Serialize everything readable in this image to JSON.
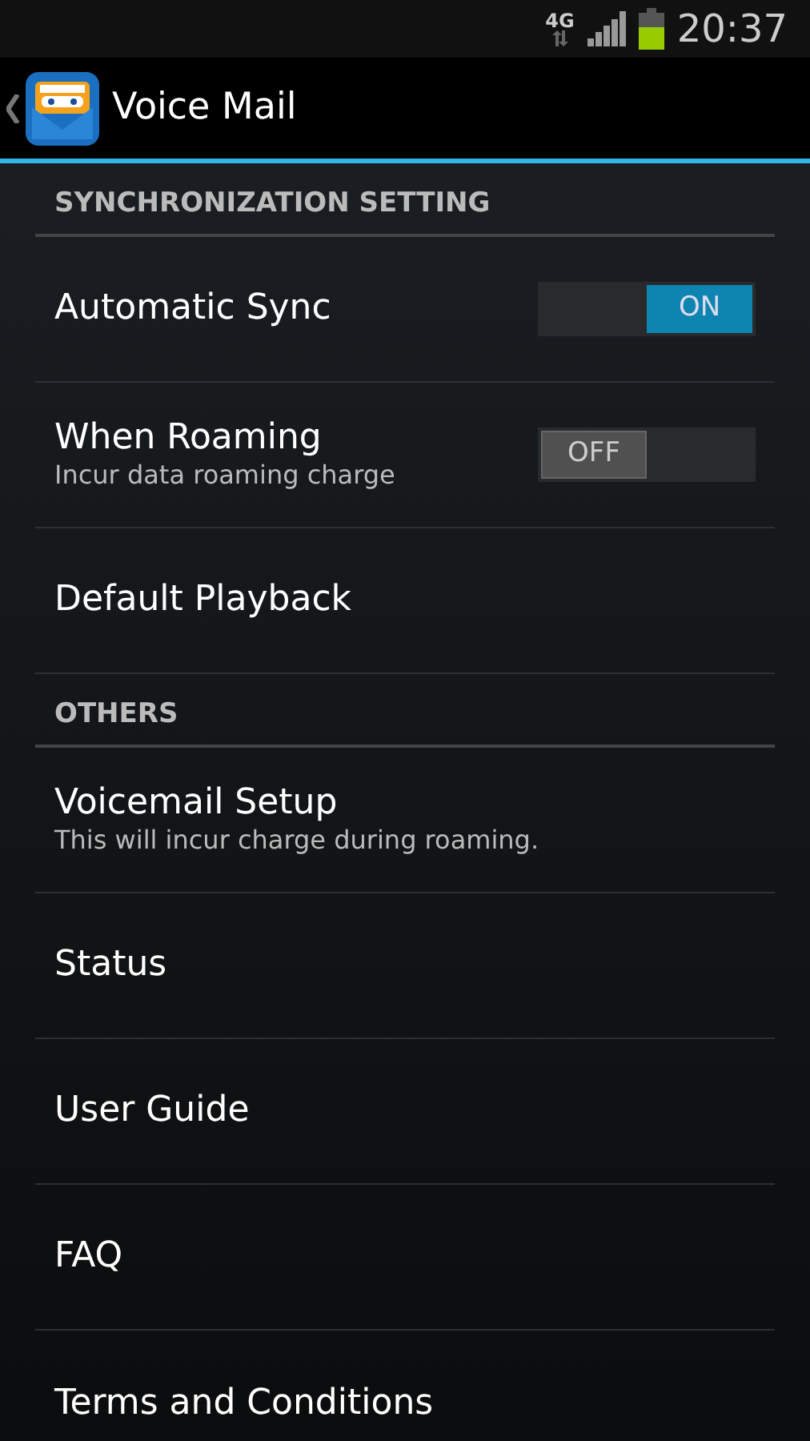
{
  "status_bar": {
    "network": "4G",
    "time": "20:37"
  },
  "app_bar": {
    "title": "Voice Mail"
  },
  "items": [
    {
      "kind": "header",
      "title": "SYNCHRONIZATION SETTING"
    },
    {
      "kind": "toggle",
      "title": "Automatic Sync",
      "on": true,
      "switch_text": "ON"
    },
    {
      "kind": "toggle",
      "title": "When Roaming",
      "subtitle": "Incur data roaming charge",
      "on": false,
      "switch_text": "OFF"
    },
    {
      "kind": "item",
      "title": "Default Playback"
    },
    {
      "kind": "header",
      "title": "OTHERS"
    },
    {
      "kind": "item",
      "title": "Voicemail Setup",
      "subtitle": "This will incur charge during roaming."
    },
    {
      "kind": "item",
      "title": "Status"
    },
    {
      "kind": "item",
      "title": "User Guide"
    },
    {
      "kind": "item",
      "title": "FAQ"
    },
    {
      "kind": "item",
      "title": "Terms and Conditions"
    }
  ]
}
